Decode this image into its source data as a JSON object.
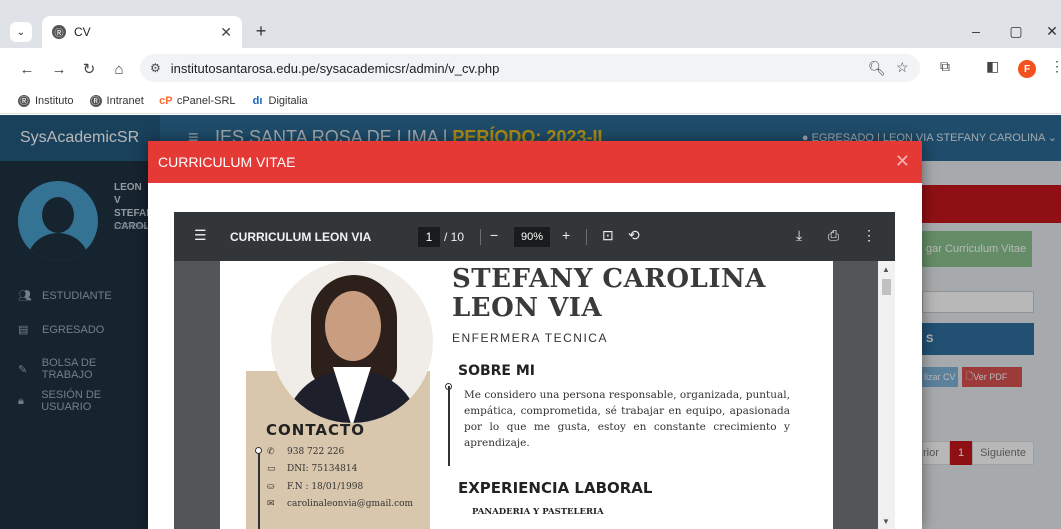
{
  "browser": {
    "tab_title": "CV",
    "tab_favicon": "institute-logo-icon",
    "url": "institutosantarosa.edu.pe/sysacademicsr/admin/v_cv.php",
    "profile_initial": "F",
    "bookmarks": [
      {
        "label": "Instituto",
        "icon": "institute-logo-icon"
      },
      {
        "label": "Intranet",
        "icon": "institute-logo-icon"
      },
      {
        "label": "cPanel-SRL",
        "icon": "cpanel-logo-icon"
      },
      {
        "label": "Digitalia",
        "icon": "digitalia-logo-icon"
      }
    ]
  },
  "app": {
    "brand": "SysAcademicSR",
    "institution": "IES SANTA ROSA DE LIMA | ",
    "period": "PERÍODO: 2023-II",
    "user_bar": "EGRESADO | LEON VIA STEFANY CAROLINA",
    "sidebar": {
      "user_name_lines": [
        "LEON V",
        "STEFAI",
        "CAROL"
      ],
      "user_role": "EGRESA",
      "menu": [
        {
          "label": "ESTUDIANTE",
          "icon": "users-icon"
        },
        {
          "label": "EGRESADO",
          "icon": "graduate-icon"
        },
        {
          "label": "BOLSA DE TRABAJO",
          "icon": "edit-icon"
        },
        {
          "label": "SESIÓN DE USUARIO",
          "icon": "lock-icon"
        }
      ]
    },
    "right_panel": {
      "upload_button": "gar Curriculum Vitae",
      "section_header": "S",
      "update_cv_button": "lizar CV",
      "view_pdf_button": "Ver PDF",
      "prev_label": "rior",
      "page_number": "1",
      "next_label": "Siguiente"
    }
  },
  "modal": {
    "title": "CURRICULUM VITAE",
    "pdf": {
      "doc_title": "CURRICULUM LEON VIA",
      "current_page": "1",
      "total_pages": "/ 10",
      "zoom": "90%"
    },
    "cv": {
      "name_line1": "STEFANY CAROLINA",
      "name_line2": "LEON VIA",
      "profession": "ENFERMERA TECNICA",
      "about_title": "SOBRE MI",
      "about_text": "Me considero una persona responsable, organizada, puntual, empática, comprometida, sé trabajar en equipo, apasionada por lo que me gusta, estoy en constante crecimiento y aprendizaje.",
      "contact_title": "CONTACTO",
      "contact": [
        {
          "icon": "phone-icon",
          "text": "938 722 226"
        },
        {
          "icon": "id-card-icon",
          "text": "DNI: 75134814"
        },
        {
          "icon": "birthday-cake-icon",
          "text": "F.N : 18/01/1998"
        },
        {
          "icon": "mail-icon",
          "text": "carolinaleonvia@gmail.com"
        }
      ],
      "experience_title": "EXPERIENCIA LABORAL",
      "company": "PANADERIA Y PASTELERIA"
    }
  }
}
